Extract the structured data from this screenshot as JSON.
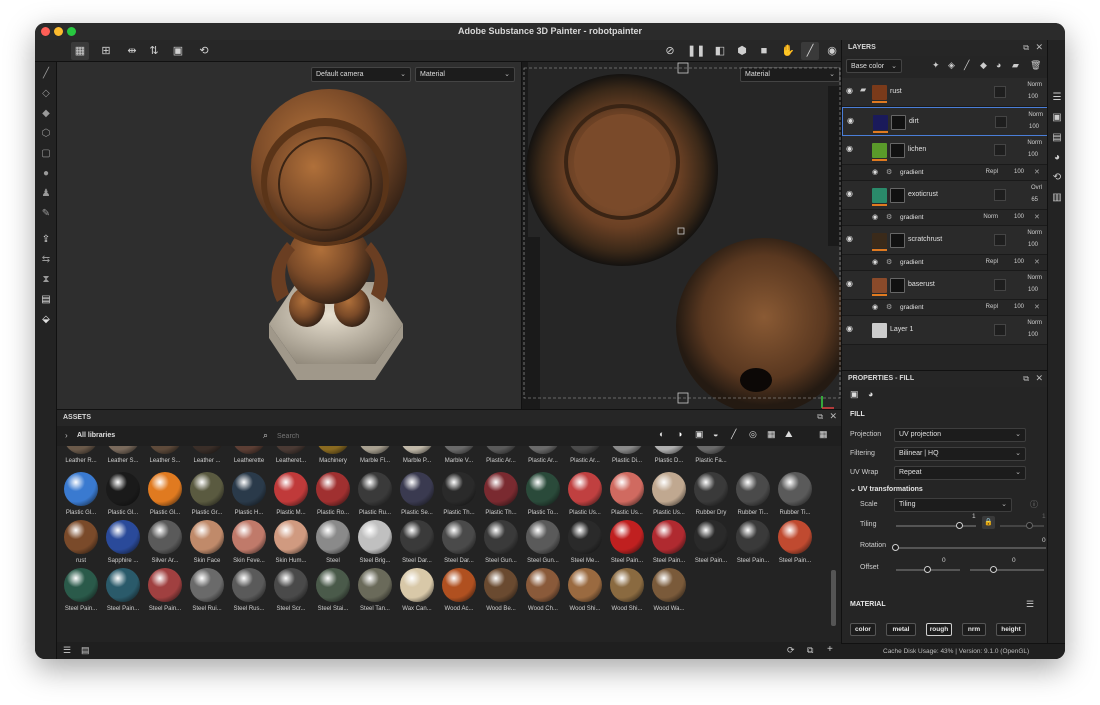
{
  "window": {
    "title": "Adobe Substance 3D Painter - robotpainter"
  },
  "viewport": {
    "camera_select": "Default camera",
    "material_select_3d": "Material",
    "material_select_2d": "Material"
  },
  "assets": {
    "title": "ASSETS",
    "library_label": "All libraries",
    "search_placeholder": "Search",
    "row0": [
      "Leather R...",
      "Leather S...",
      "Leather S...",
      "Leather ...",
      "Leatherette",
      "Leatheret...",
      "Machinery",
      "Marble Fl...",
      "Marble P...",
      "Marble V...",
      "Plastic Ar...",
      "Plastic Ar...",
      "Plastic Ar...",
      "Plastic Di...",
      "Plastic D...",
      "Plastic Fa..."
    ],
    "row1": [
      "Plastic Gl...",
      "Plastic Gl...",
      "Plastic Gl...",
      "Plastic Gr...",
      "Plastic H...",
      "Plastic M...",
      "Plastic Ro...",
      "Plastic Ru...",
      "Plastic Se...",
      "Plastic Th...",
      "Plastic Th...",
      "Plastic To...",
      "Plastic Us...",
      "Plastic Us...",
      "Plastic Us...",
      "Rubber Dry",
      "Rubber Ti...",
      "Rubber Ti..."
    ],
    "row2": [
      "rust",
      "Sapphire ...",
      "Silver Ar...",
      "Skin Face",
      "Skin Feve...",
      "Skin Hum...",
      "Steel",
      "Steel Brig...",
      "Steel Dar...",
      "Steel Dar...",
      "Steel Gun...",
      "Steel Gun...",
      "Steel Me...",
      "Steel Pain...",
      "Steel Pain...",
      "Steel Pain...",
      "Steel Pain...",
      "Steel Pain..."
    ],
    "row3": [
      "Steel Pain...",
      "Steel Pain...",
      "Steel Pain...",
      "Steel Rui...",
      "Steel Rus...",
      "Steel Scr...",
      "Steel Stai...",
      "Steel Tan...",
      "Wax Can...",
      "Wood Ac...",
      "Wood Be...",
      "Wood Ch...",
      "Wood Shi...",
      "Wood Shi...",
      "Wood Wa..."
    ],
    "row0_colors": [
      "#6b5a4a",
      "#7a6a5c",
      "#5e4a3a",
      "#3a2e28",
      "#5c3e34",
      "#4a3a34",
      "#8a6a20",
      "#a8a090",
      "#c0b8a8",
      "#6a6a6a",
      "#5a5a5a",
      "#6a6a6a",
      "#4a4a4a",
      "#8a8a8a",
      "#b0b0b0",
      "#6a6a6a"
    ],
    "row1_colors": [
      "#3a7ad0",
      "#1a1a1a",
      "#e07a20",
      "#5a5a40",
      "#2a3a4a",
      "#c03a3a",
      "#a03030",
      "#3a3a3a",
      "#3a3a50",
      "#2a2a2a",
      "#7a2a30",
      "#2a4a3a",
      "#c04040",
      "#d06a60",
      "#c0a890",
      "#3a3a3a",
      "#4a4a4a",
      "#5a5a5a"
    ],
    "row2_colors": [
      "#7a4a2a",
      "#2a4a9a",
      "#5a5a5a",
      "#c08a6a",
      "#c07a6a",
      "#d09a80",
      "#8a8a8a",
      "#c0c0c0",
      "#3a3a3a",
      "#4a4a4a",
      "#3a3a3a",
      "#5a5a5a",
      "#2a2a2a",
      "#c02020",
      "#b02a30",
      "#2a2a2a",
      "#3a3a3a",
      "#c04a30"
    ],
    "row3_colors": [
      "#2a5a4a",
      "#2a5a6a",
      "#a04040",
      "#6a6a6a",
      "#5a5a5a",
      "#4a4a4a",
      "#4a5a4a",
      "#6a6a5a",
      "#d8c8a8",
      "#b05020",
      "#6a4a30",
      "#8a5a3a",
      "#9a6a40",
      "#8a6a40",
      "#7a5a3a"
    ]
  },
  "layers": {
    "title": "LAYERS",
    "channel_select": "Base color",
    "items": [
      {
        "name": "rust",
        "blend": "Norm",
        "opacity": "100",
        "kind": "folder",
        "color": "#7a3a1a"
      },
      {
        "name": "dirt",
        "blend": "Norm",
        "opacity": "100",
        "kind": "fill",
        "color": "#1a1a5a"
      },
      {
        "name": "lichen",
        "blend": "Norm",
        "opacity": "100",
        "kind": "fill",
        "color": "#5a9a2a"
      },
      {
        "name": "exoticrust",
        "blend": "Ovrl",
        "opacity": "65",
        "kind": "fill",
        "color": "#2a8a6a"
      },
      {
        "name": "scratchrust",
        "blend": "Norm",
        "opacity": "100",
        "kind": "fill",
        "color": "#3a2a1a"
      },
      {
        "name": "baserust",
        "blend": "Norm",
        "opacity": "100",
        "kind": "fill",
        "color": "#8a4a2a"
      },
      {
        "name": "Layer 1",
        "blend": "Norm",
        "opacity": "100",
        "kind": "paint",
        "color": "#cccccc"
      }
    ],
    "gradients": [
      {
        "name": "gradient",
        "blend": "Repl",
        "opacity": "100"
      },
      {
        "name": "gradient",
        "blend": "Norm",
        "opacity": "100"
      },
      {
        "name": "gradient",
        "blend": "Repl",
        "opacity": "100"
      },
      {
        "name": "gradient",
        "blend": "Repl",
        "opacity": "100"
      }
    ]
  },
  "properties": {
    "title": "PROPERTIES - FILL",
    "section_fill": "FILL",
    "projection_label": "Projection",
    "projection_value": "UV projection",
    "filtering_label": "Filtering",
    "filtering_value": "Bilinear | HQ",
    "uvwrap_label": "UV Wrap",
    "uvwrap_value": "Repeat",
    "uvtrans_label": "UV transformations",
    "scale_label": "Scale",
    "scale_value": "Tiling",
    "tiling_label": "Tiling",
    "tiling_value_1": "1",
    "tiling_value_2": "1",
    "rotation_label": "Rotation",
    "rotation_value": "0",
    "offset_label": "Offset",
    "offset_value_1": "0",
    "offset_value_2": "0",
    "section_material": "MATERIAL",
    "channels": [
      "color",
      "metal",
      "rough",
      "nrm",
      "height"
    ],
    "active_channel": 2
  },
  "status": {
    "text": "Cache Disk Usage:    43% | Version: 9.1.0 (OpenGL)"
  }
}
